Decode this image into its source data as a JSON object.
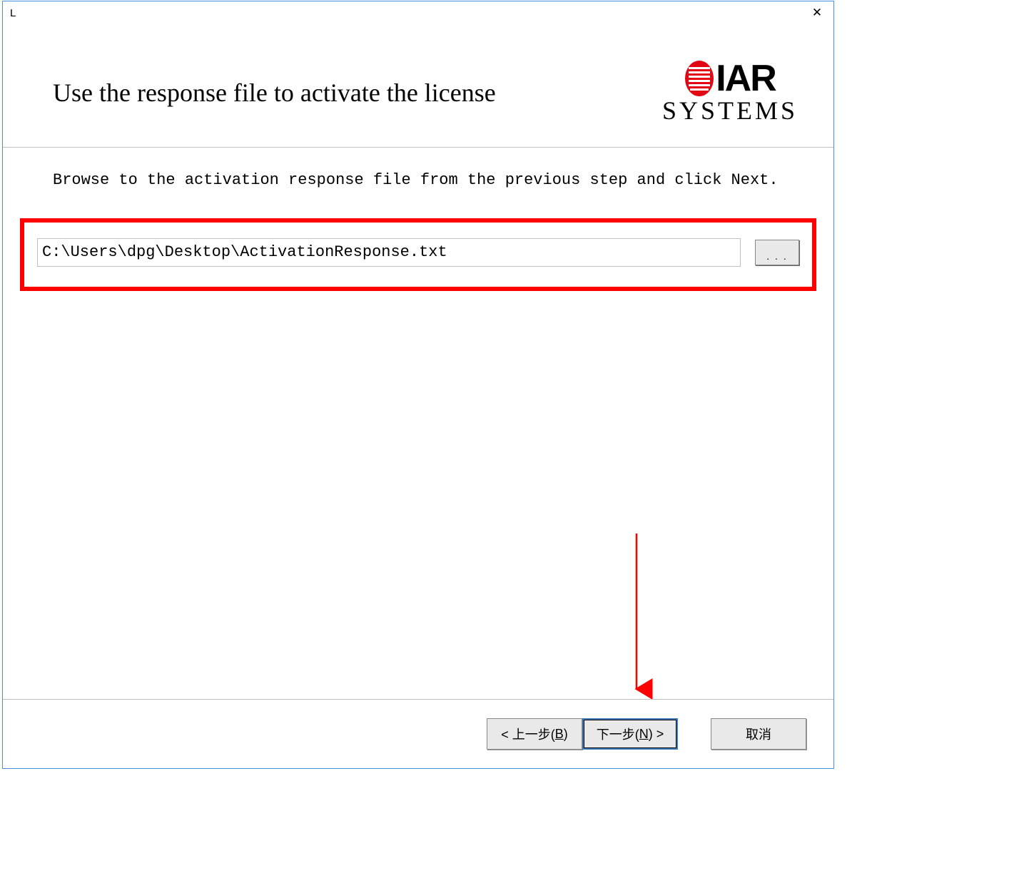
{
  "titlebar": {
    "letter": "L",
    "close_icon": "✕"
  },
  "header": {
    "title": "Use the response file to activate the license",
    "logo_iar": "IAR",
    "logo_systems": "SYSTEMS"
  },
  "instruction": "Browse to the activation response file from the previous step and click Next.",
  "file": {
    "path": "C:\\Users\\dpg\\Desktop\\ActivationResponse.txt",
    "browse_label": ". . ."
  },
  "footer": {
    "back_prefix": "< 上一步(",
    "back_hotkey": "B",
    "back_suffix": ")",
    "next_prefix": "下一步(",
    "next_hotkey": "N",
    "next_suffix": ") >",
    "cancel": "取消"
  },
  "colors": {
    "highlight": "#ff0000",
    "arrow": "#ff0000",
    "logo_red": "#e30613"
  }
}
